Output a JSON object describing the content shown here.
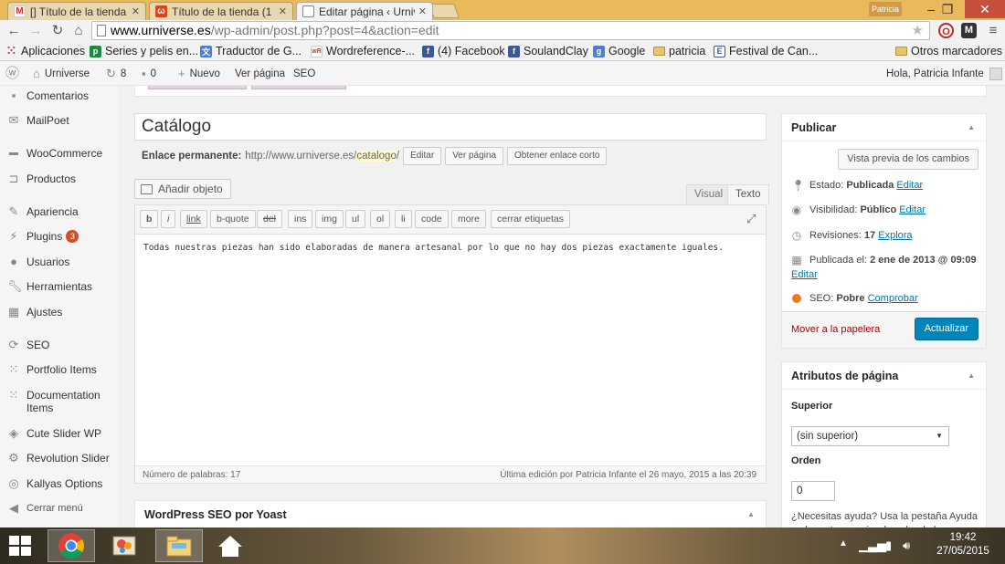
{
  "browser": {
    "tabs": [
      {
        "label": "[] Título de la tienda",
        "favicon": "gmail-icon"
      },
      {
        "label": "Título de la tienda (1",
        "favicon": "wolfram-icon"
      },
      {
        "label": "Editar página ‹ Urniv",
        "favicon": "page-icon"
      }
    ],
    "user_chip": "Patricia",
    "url_domain": "www.urniverse.es",
    "url_path": "/wp-admin/post.php?post=4&action=edit",
    "bookmarks": [
      {
        "label": "Aplicaciones",
        "icon": "apps-grid-icon"
      },
      {
        "label": "Series y pelis en...",
        "icon": "p-icon"
      },
      {
        "label": "Traductor de G...",
        "icon": "translate-icon"
      },
      {
        "label": "Wordreference-...",
        "icon": "wr-icon"
      },
      {
        "label": "(4) Facebook",
        "icon": "facebook-icon"
      },
      {
        "label": "SoulandClay",
        "icon": "facebook-icon"
      },
      {
        "label": "Google",
        "icon": "google-icon"
      },
      {
        "label": "patricia",
        "icon": "folder-icon"
      },
      {
        "label": "Festival de Can...",
        "icon": "e-icon"
      }
    ],
    "other_bookmarks": "Otros marcadores"
  },
  "adminbar": {
    "site": "Urniverse",
    "updates": "8",
    "comments": "0",
    "new_label": "Nuevo",
    "view_page": "Ver página",
    "seo": "SEO",
    "greeting": "Hola, Patricia Infante"
  },
  "sidebar": {
    "items": [
      {
        "label": "Comentarios",
        "icon": "comment-icon"
      },
      {
        "label": "MailPoet",
        "icon": "mail-icon"
      },
      {
        "label": "WooCommerce",
        "icon": "woo-icon"
      },
      {
        "label": "Productos",
        "icon": "cart-icon"
      },
      {
        "label": "Apariencia",
        "icon": "brush-icon"
      },
      {
        "label": "Plugins",
        "icon": "plug-icon",
        "badge": "3"
      },
      {
        "label": "Usuarios",
        "icon": "user-icon"
      },
      {
        "label": "Herramientas",
        "icon": "wrench-icon"
      },
      {
        "label": "Ajustes",
        "icon": "settings-icon"
      },
      {
        "label": "SEO",
        "icon": "seo-icon"
      },
      {
        "label": "Portfolio Items",
        "icon": "grid-icon"
      },
      {
        "label": "Documentation Items",
        "icon": "grid-icon"
      },
      {
        "label": "Cute Slider WP",
        "icon": "slider-icon"
      },
      {
        "label": "Revolution Slider",
        "icon": "gear-icon"
      },
      {
        "label": "Kallyas Options",
        "icon": "options-icon"
      },
      {
        "label": "Cerrar menú",
        "icon": "collapse-icon"
      }
    ]
  },
  "editor": {
    "title": "Catálogo",
    "permalink_label": "Enlace permanente:",
    "permalink_base": "http://www.urniverse.es/",
    "permalink_slug": "catalogo",
    "permalink_trailing": "/",
    "btn_edit": "Editar",
    "btn_view": "Ver página",
    "btn_shortlink": "Obtener enlace corto",
    "add_media": "Añadir objeto",
    "tab_visual": "Visual",
    "tab_text": "Texto",
    "quicktags": [
      "b",
      "i",
      "link",
      "b-quote",
      "del",
      "ins",
      "img",
      "ul",
      "ol",
      "li",
      "code",
      "more",
      "cerrar etiquetas"
    ],
    "content": "Todas nuestras piezas han sido elaboradas de manera artesanal por lo que no hay dos piezas exactamente iguales.",
    "word_count": "Número de palabras: 17",
    "last_edit": "Última edición por Patricia Infante el 26 mayo, 2015 a las 20:39"
  },
  "yoast": {
    "title": "WordPress SEO por Yoast"
  },
  "publish": {
    "title": "Publicar",
    "preview": "Vista previa de los cambios",
    "status_label": "Estado:",
    "status_value": "Publicada",
    "visibility_label": "Visibilidad:",
    "visibility_value": "Público",
    "revisions_label": "Revisiones:",
    "revisions_value": "17",
    "revisions_link": "Explora",
    "published_label": "Publicada el:",
    "published_value": "2 ene de 2013 @ 09:09",
    "seo_label": "SEO:",
    "seo_value": "Pobre",
    "seo_link": "Comprobar",
    "edit_link": "Editar",
    "trash": "Mover a la papelera",
    "update": "Actualizar",
    "seo_color": "#ee7c1b"
  },
  "attributes": {
    "title": "Atributos de página",
    "parent_label": "Superior",
    "parent_value": "(sin superior)",
    "order_label": "Orden",
    "order_value": "0",
    "help": "¿Necesitas ayuda? Usa la pestaña Ayuda en la parte superior derecha de la"
  },
  "taskbar": {
    "time": "19:42",
    "date": "27/05/2015"
  }
}
